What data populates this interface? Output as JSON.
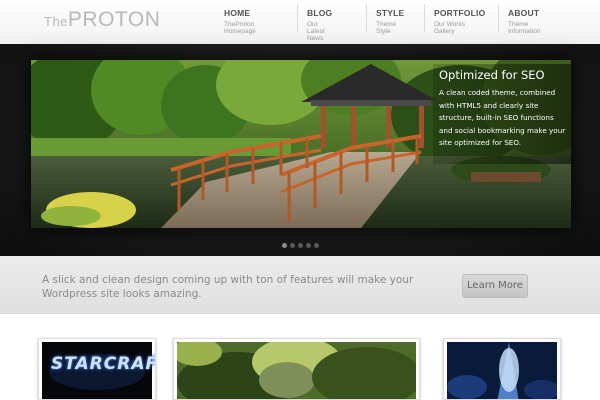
{
  "logo": {
    "prefix": "The",
    "name": "PROTON"
  },
  "nav": [
    {
      "title": "HOME",
      "subtitle": "TheProton Homepage"
    },
    {
      "title": "BLOG",
      "subtitle": "Our Latest News"
    },
    {
      "title": "STYLE",
      "subtitle": "Theme Style"
    },
    {
      "title": "PORTFOLIO",
      "subtitle": "Our Works Gallery"
    },
    {
      "title": "ABOUT",
      "subtitle": "Theme Information"
    }
  ],
  "slider": {
    "caption_title": "Optimized for SEO",
    "caption_text": "A clean coded theme, combined with HTML5 and clearly site structure, built-in SEO functions and social bookmarking make your site optimized for SEO.",
    "slide_count": 5,
    "active_slide": 1
  },
  "promo": {
    "text": "A slick and clean design coming up with ton of features will make your Wordpress site looks amazing.",
    "button_label": "Learn More"
  },
  "portfolio": [
    {
      "label": "STARCRAFT"
    },
    {
      "label": ""
    },
    {
      "label": ""
    }
  ],
  "colors": {
    "accent_dark": "#161616",
    "promo_band": "#e6e6e6",
    "nav_title": "#555555"
  }
}
